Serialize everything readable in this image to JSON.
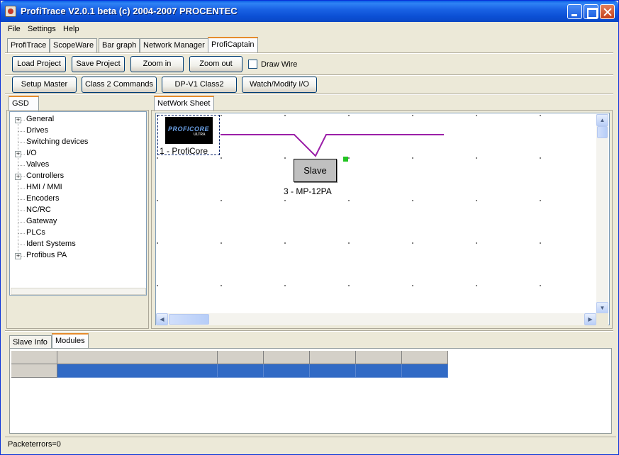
{
  "window": {
    "title": "ProfiTrace  V2.0.1 beta (c) 2004-2007 PROCENTEC"
  },
  "menu": [
    "File",
    "Settings",
    "Help"
  ],
  "tabs": {
    "main": [
      "ProfiTrace",
      "ScopeWare",
      "Bar graph",
      "Network Manager",
      "ProfiCaptain"
    ],
    "active": "ProfiCaptain"
  },
  "toolbar": {
    "load_project": "Load Project",
    "save_project": "Save Project",
    "zoom_in": "Zoom in",
    "zoom_out": "Zoom out",
    "draw_wire": "Draw Wire",
    "draw_wire_checked": false
  },
  "toolbar2": {
    "setup_master": "Setup Master",
    "class2_commands": "Class 2 Commands",
    "dpv1_class2": "DP-V1 Class2",
    "watch_modify": "Watch/Modify I/O"
  },
  "gsd": {
    "tab": "GSD",
    "items": [
      {
        "label": "General",
        "expandable": true
      },
      {
        "label": "Drives",
        "expandable": false
      },
      {
        "label": "Switching devices",
        "expandable": false
      },
      {
        "label": "I/O",
        "expandable": true
      },
      {
        "label": "Valves",
        "expandable": false
      },
      {
        "label": "Controllers",
        "expandable": true
      },
      {
        "label": "HMI / MMI",
        "expandable": false
      },
      {
        "label": "Encoders",
        "expandable": false
      },
      {
        "label": "NC/RC",
        "expandable": false
      },
      {
        "label": "Gateway",
        "expandable": false
      },
      {
        "label": "PLCs",
        "expandable": false
      },
      {
        "label": "Ident Systems",
        "expandable": false
      },
      {
        "label": "Profibus PA",
        "expandable": true
      }
    ]
  },
  "network": {
    "tab": "NetWork Sheet",
    "master": {
      "label": "1 - ProfiCore",
      "logo_text": "PROFICORE",
      "logo_sub": "ULTRA"
    },
    "slave": {
      "box_text": "Slave",
      "label": "3 - MP-12PA"
    },
    "wire_color": "#9b1fa8"
  },
  "bottom": {
    "tabs": [
      "Slave Info",
      "Modules"
    ],
    "active": "Modules"
  },
  "status": {
    "text": "Packeterrors=0"
  }
}
